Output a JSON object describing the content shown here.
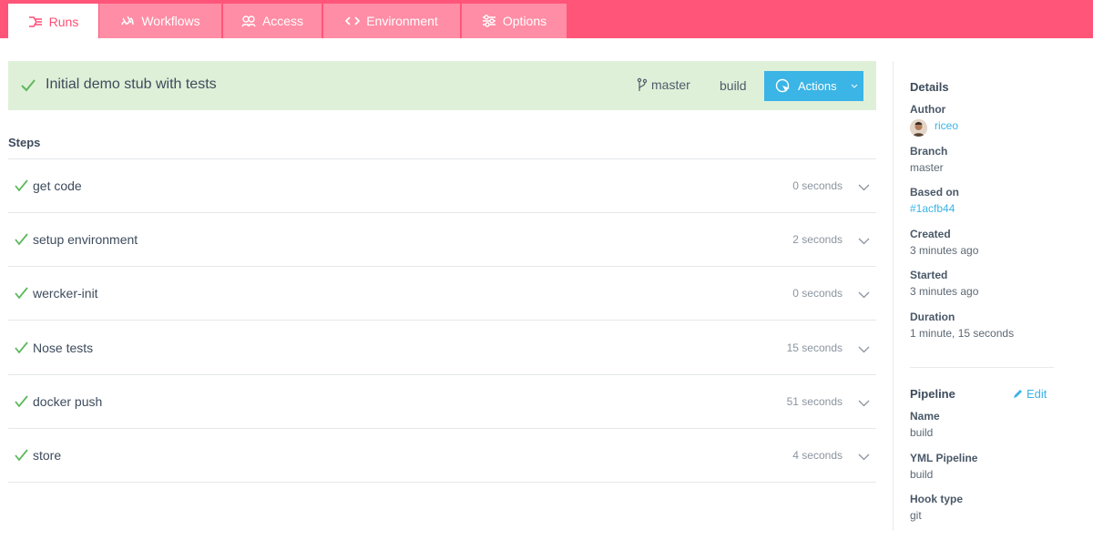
{
  "tabs": [
    {
      "label": "Runs",
      "icon": "runs-icon"
    },
    {
      "label": "Workflows",
      "icon": "workflows-icon"
    },
    {
      "label": "Access",
      "icon": "access-icon"
    },
    {
      "label": "Environment",
      "icon": "code-icon"
    },
    {
      "label": "Options",
      "icon": "options-icon"
    }
  ],
  "run": {
    "title": "Initial demo stub with tests",
    "branch": "master",
    "pipeline": "build",
    "actions_label": "Actions",
    "status": "passed"
  },
  "steps_title": "Steps",
  "steps": [
    {
      "name": "get code",
      "duration": "0 seconds"
    },
    {
      "name": "setup environment",
      "duration": "2 seconds"
    },
    {
      "name": "wercker-init",
      "duration": "0 seconds"
    },
    {
      "name": "Nose tests",
      "duration": "15 seconds"
    },
    {
      "name": "docker push",
      "duration": "51 seconds"
    },
    {
      "name": "store",
      "duration": "4 seconds"
    }
  ],
  "details": {
    "title": "Details",
    "author_label": "Author",
    "author": "riceo",
    "branch_label": "Branch",
    "branch": "master",
    "based_on_label": "Based on",
    "based_on": "#1acfb44",
    "created_label": "Created",
    "created": "3 minutes ago",
    "started_label": "Started",
    "started": "3 minutes ago",
    "duration_label": "Duration",
    "duration": "1 minute, 15 seconds"
  },
  "pipeline": {
    "title": "Pipeline",
    "edit_label": "Edit",
    "name_label": "Name",
    "name": "build",
    "yml_label": "YML Pipeline",
    "yml": "build",
    "hook_label": "Hook type",
    "hook": "git"
  },
  "colors": {
    "brand": "#ff5579",
    "tab_inactive": "#ff8da5",
    "success_bg": "#dff0d8",
    "success": "#5cb85c",
    "accent": "#3bb4e6"
  }
}
